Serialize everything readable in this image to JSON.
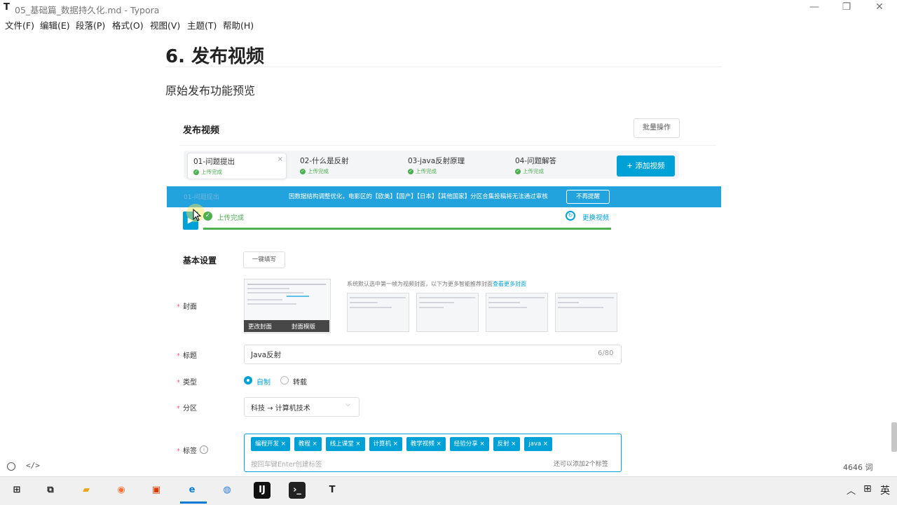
{
  "window": {
    "app_icon": "T",
    "title": "05_基础篇_数据持久化.md - Typora",
    "controls": {
      "minimize": "—",
      "maximize": "❐",
      "close": "✕"
    }
  },
  "menu": [
    "文件(F)",
    "编辑(E)",
    "段落(P)",
    "格式(O)",
    "视图(V)",
    "主题(T)",
    "帮助(H)"
  ],
  "doc": {
    "heading": "6. 发布视频",
    "paragraph": "原始发布功能预览"
  },
  "publish": {
    "title": "发布视频",
    "batch_button": "批量操作",
    "tabs": [
      {
        "title": "01-问题提出",
        "status": "上传完成",
        "active": true,
        "close": "×"
      },
      {
        "title": "02-什么是反射",
        "status": "上传完成",
        "active": false
      },
      {
        "title": "03-java反射原理",
        "status": "上传完成",
        "active": false
      },
      {
        "title": "04-问题解答",
        "status": "上传完成",
        "active": false
      }
    ],
    "add_video_button": "+ 添加视频",
    "notice": {
      "text": "因数据结构调整优化，电影区的【欧美】【国产】【日本】【其他国家】分区合集投稿将无法通过审核",
      "button": "不再提醒",
      "ghost_text": "01-问题提出"
    },
    "upload": {
      "status": "上传完成",
      "check_glyph": "✓",
      "replace_label": "更换视频",
      "replace_glyph": "↻",
      "progress": 1.0
    },
    "basic": {
      "title": "基本设置",
      "autofill_button": "一键填写"
    },
    "cover": {
      "label": "封面",
      "edit_button": "更改封面",
      "template_button": "封面模版",
      "hint": "系统默认选中第一帧为视频封面，以下为更多智能推荐封面",
      "hint_link": "查看更多封面"
    },
    "title_field": {
      "label": "标题",
      "value": "Java反射",
      "count": "6/80"
    },
    "type_field": {
      "label": "类型",
      "options": [
        "自制",
        "转载"
      ],
      "selected": "自制"
    },
    "zone_field": {
      "label": "分区",
      "value": "科技 → 计算机技术",
      "chevron": "⌵"
    },
    "tags_field": {
      "label": "标签",
      "info_glyph": "i",
      "tags": [
        "编程开发",
        "教程",
        "线上课堂",
        "计算机",
        "教学视频",
        "经验分享",
        "反射",
        "java"
      ],
      "remove_glyph": "×",
      "placeholder": "按回车键Enter创建标签",
      "remaining": "还可以添加2个标签"
    },
    "required_mark": "*"
  },
  "status_bar": {
    "code_toggle": "</>",
    "word_count": "4646 词"
  },
  "taskbar": {
    "icons": [
      {
        "name": "windows-start-icon",
        "glyph": "⊞",
        "color": "#1a1a1a"
      },
      {
        "name": "task-view-icon",
        "glyph": "⧉",
        "color": "#1a1a1a"
      },
      {
        "name": "file-explorer-icon",
        "glyph": "▰",
        "color": "#e8a317"
      },
      {
        "name": "firefox-icon",
        "glyph": "◉",
        "color": "#ff7139"
      },
      {
        "name": "office-icon",
        "glyph": "▣",
        "color": "#d83b01"
      },
      {
        "name": "edge-icon",
        "glyph": "e",
        "color": "#0c7cd5"
      },
      {
        "name": "search-app-icon",
        "glyph": "◍",
        "color": "#2d7de0"
      },
      {
        "name": "intellij-icon",
        "glyph": "IJ",
        "color": "#ffffff"
      },
      {
        "name": "terminal-icon",
        "glyph": "›_",
        "color": "#ffffff"
      },
      {
        "name": "typora-icon",
        "glyph": "T",
        "color": "#222222"
      }
    ],
    "tray": {
      "chevron": "︿",
      "ime_mode": "⊞",
      "ime_lang": "英"
    }
  },
  "colors": {
    "accent": "#00a1d6",
    "success": "#4caf50",
    "notice_bg": "#23a3dd",
    "required": "#f25d8e"
  }
}
